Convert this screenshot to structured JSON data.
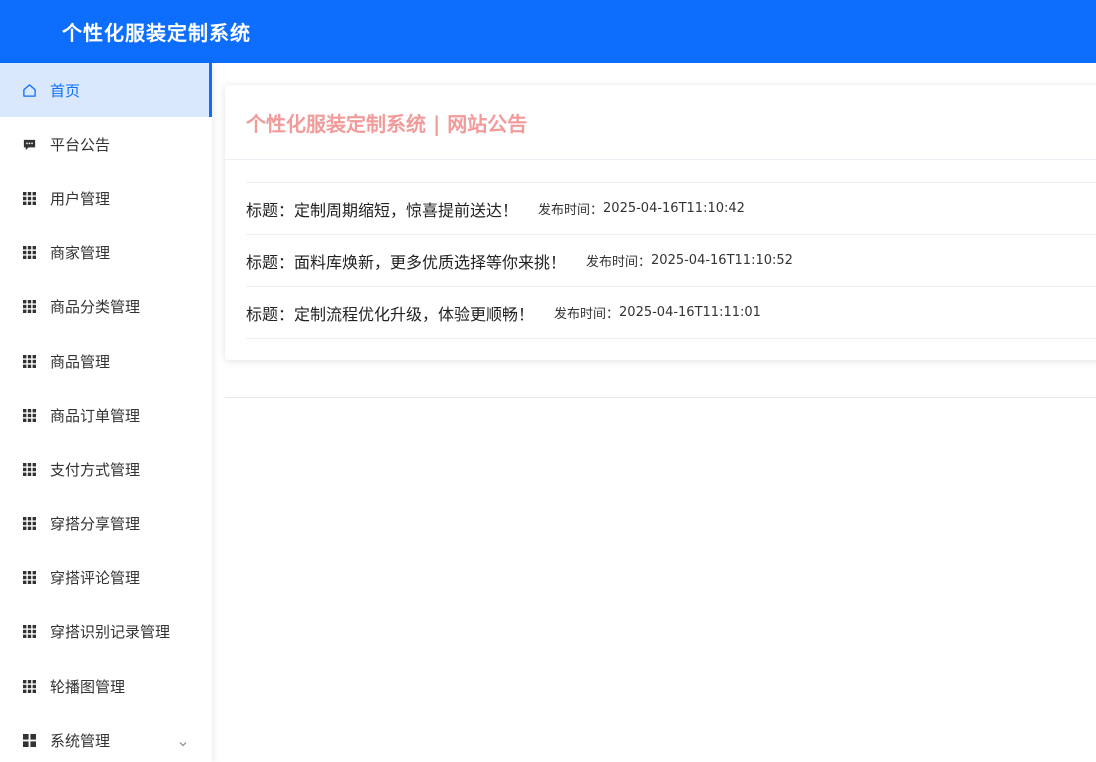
{
  "app": {
    "title": "个性化服装定制系统"
  },
  "sidebar": {
    "items": [
      {
        "label": "首页",
        "icon": "home-icon",
        "active": true
      },
      {
        "label": "平台公告",
        "icon": "message-icon"
      },
      {
        "label": "用户管理",
        "icon": "grid-icon"
      },
      {
        "label": "商家管理",
        "icon": "grid-icon"
      },
      {
        "label": "商品分类管理",
        "icon": "grid-icon"
      },
      {
        "label": "商品管理",
        "icon": "grid-icon"
      },
      {
        "label": "商品订单管理",
        "icon": "grid-icon"
      },
      {
        "label": "支付方式管理",
        "icon": "grid-icon"
      },
      {
        "label": "穿搭分享管理",
        "icon": "grid-icon"
      },
      {
        "label": "穿搭评论管理",
        "icon": "grid-icon"
      },
      {
        "label": "穿搭识别记录管理",
        "icon": "grid-icon"
      },
      {
        "label": "轮播图管理",
        "icon": "grid-icon"
      },
      {
        "label": "系统管理",
        "icon": "apps-icon",
        "expandable": true
      }
    ]
  },
  "announcements": {
    "heading": "个性化服装定制系统 | 网站公告",
    "items": [
      {
        "title": "标题：定制周期缩短，惊喜提前送达！",
        "time_label": "发布时间：",
        "time": "2025-04-16T11:10:42"
      },
      {
        "title": "标题：面料库焕新，更多优质选择等你来挑！",
        "time_label": "发布时间：",
        "time": "2025-04-16T11:10:52"
      },
      {
        "title": "标题：定制流程优化升级，体验更顺畅！",
        "time_label": "发布时间：",
        "time": "2025-04-16T11:11:01"
      }
    ]
  },
  "colors": {
    "header_bg": "#0d6efd",
    "active_bg": "#d9e8fc",
    "active_text": "#0d6efd",
    "heading_text": "#f29b9b"
  }
}
